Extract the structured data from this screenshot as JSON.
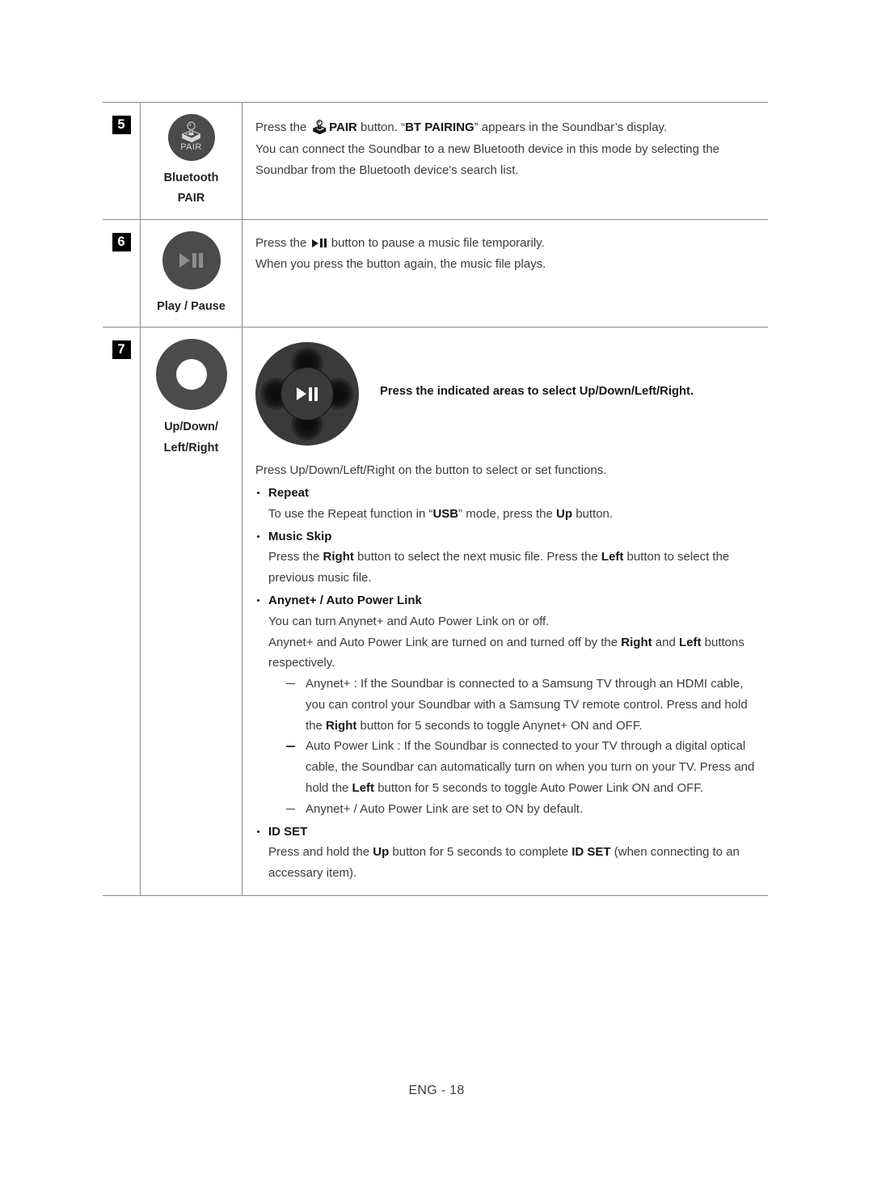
{
  "page": {
    "footer": "ENG - 18"
  },
  "table": {
    "rows": [
      {
        "number": "5",
        "icon": "bluetooth-pair-button-icon",
        "icon_badge_text": "PAIR",
        "label_lines": [
          "Bluetooth",
          "PAIR"
        ],
        "paragraphs": [
          "Press the  PAIR button. “BT PAIRING” appears in the Soundbar’s display.",
          "You can connect the Soundbar to a new Bluetooth device in this mode by selecting the",
          "Soundbar from the Bluetooth device's search list."
        ],
        "line1_pre": "Press the ",
        "line1_bold_pair": "PAIR",
        "line1_mid": " button. “",
        "line1_bold_bt": "BT PAIRING",
        "line1_post": "” appears in the Soundbar’s display.",
        "line2": "You can connect the Soundbar to a new Bluetooth device in this mode by selecting the",
        "line3": "Soundbar from the Bluetooth device's search list."
      },
      {
        "number": "6",
        "icon": "play-pause-button-icon",
        "label_lines": [
          "Play / Pause"
        ],
        "line1_pre": "Press the ",
        "line1_post": " button to pause a music file temporarily.",
        "line2": "When you press the button again, the music file plays."
      },
      {
        "number": "7",
        "icon": "direction-ring-icon",
        "label_lines": [
          "Up/Down/",
          "Left/Right"
        ],
        "dpad_caption": "Press the indicated areas to select Up/Down/Left/Right.",
        "lead": "Press Up/Down/Left/Right on the button to select or set functions.",
        "bullets": [
          {
            "heading": "Repeat",
            "body_pre": "To use the Repeat function in “",
            "body_bold1": "USB",
            "body_mid": "” mode, press the ",
            "body_bold2": "Up",
            "body_post": " button."
          },
          {
            "heading": "Music Skip",
            "body_pre": "Press the ",
            "body_bold1": "Right",
            "body_mid": " button to select the next music file. Press the ",
            "body_bold2": "Left",
            "body_post": " button to select the previous music file."
          },
          {
            "heading": "Anynet+ / Auto Power Link",
            "body_line1": "You can turn Anynet+ and Auto Power Link on or off.",
            "body_line2_pre": "Anynet+ and Auto Power Link are turned on and turned off by the ",
            "body_line2_bold1": "Right",
            "body_line2_mid": " and ",
            "body_line2_bold2": "Left",
            "body_line2_post": " buttons respectively.",
            "dashes": [
              {
                "text_pre": "Anynet+ : If the Soundbar is connected to a Samsung TV through an HDMI cable, you can control your Soundbar with a Samsung TV remote control. Press and hold the ",
                "bold": "Right",
                "text_post": " button for 5 seconds to toggle Anynet+ ON and OFF."
              },
              {
                "text_pre": "Auto Power Link : If the Soundbar is connected to your TV through a digital optical cable, the Soundbar can automatically turn on when you turn on your TV. Press and hold the ",
                "bold": "Left",
                "text_post": " button for 5 seconds to toggle Auto Power Link ON and OFF."
              },
              {
                "text_pre": "Anynet+ / Auto Power Link are set to ON by default.",
                "bold": "",
                "text_post": ""
              }
            ]
          },
          {
            "heading": "ID SET",
            "body_pre": "Press and hold the ",
            "body_bold1": "Up",
            "body_mid": " button for 5 seconds to complete ",
            "body_bold2": "ID SET",
            "body_post": " (when connecting to an accessary item)."
          }
        ]
      }
    ]
  }
}
